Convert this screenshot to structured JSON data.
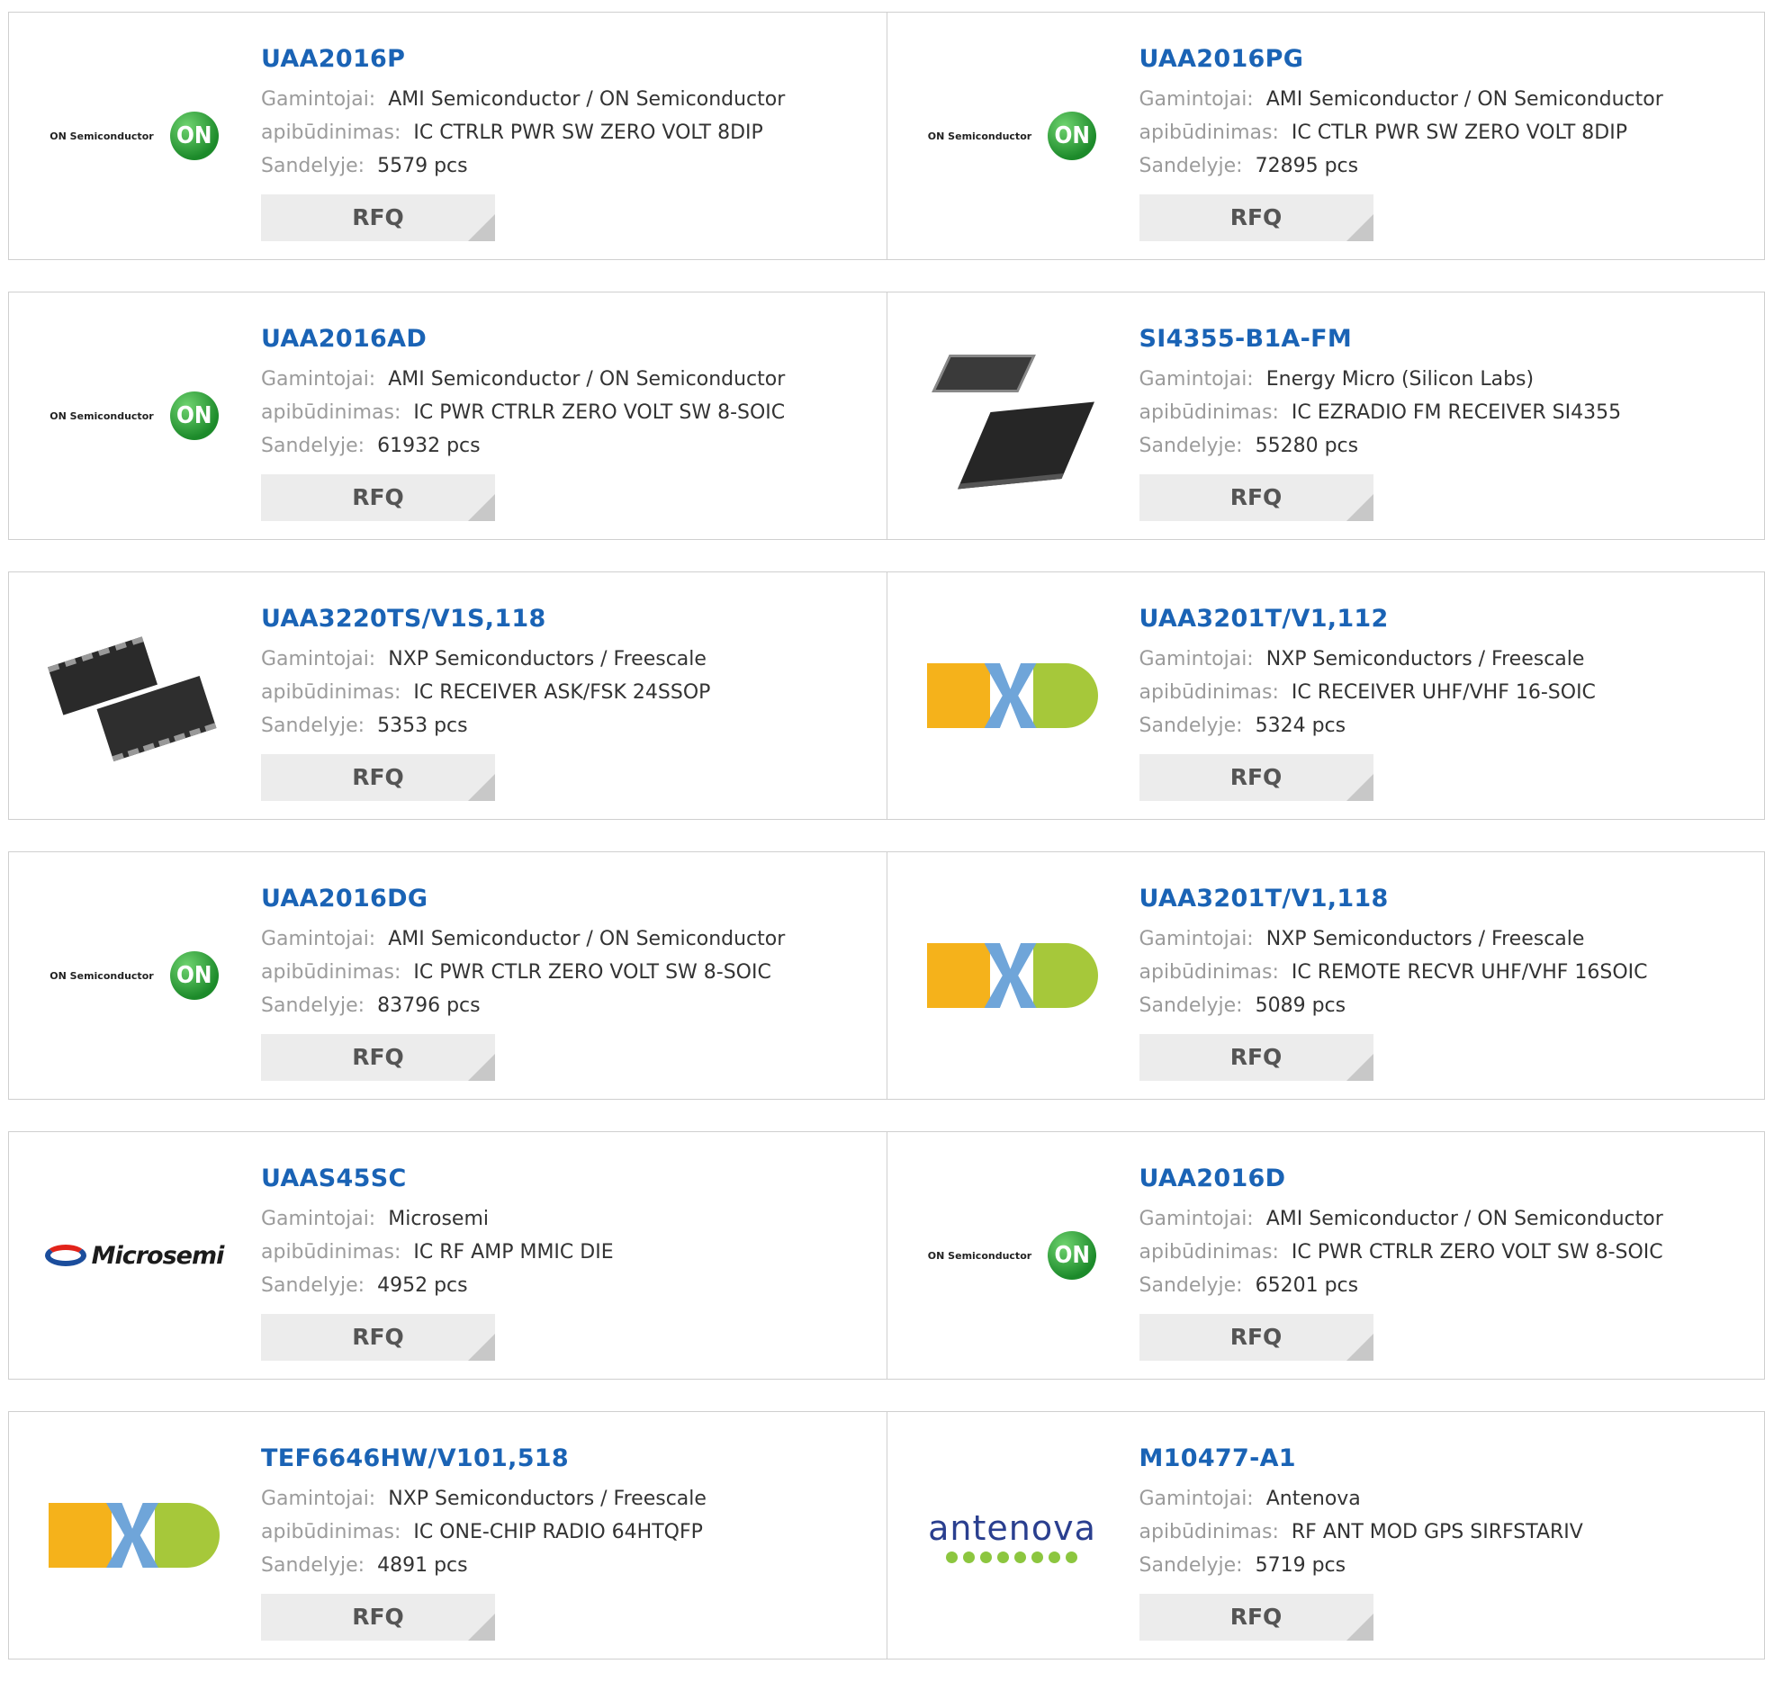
{
  "labels": {
    "manufacturer": "Gamintojai:",
    "description": "apibūdinimas:",
    "stock": "Sandelyje:",
    "rfq": "RFQ"
  },
  "colors": {
    "part_link": "#1a63b5",
    "rfq_bg": "#ececec",
    "border": "#cfcfcf"
  },
  "products": [
    {
      "part": "UAA2016P",
      "manufacturer": "AMI Semiconductor / ON Semiconductor",
      "description": "IC CTRLR PWR SW ZERO VOLT 8DIP",
      "stock": "5579 pcs",
      "image": "on-semiconductor-logo",
      "logo_text": "ON Semiconductor",
      "badge": "ON"
    },
    {
      "part": "UAA2016PG",
      "manufacturer": "AMI Semiconductor / ON Semiconductor",
      "description": "IC CTLR PWR SW ZERO VOLT 8DIP",
      "stock": "72895 pcs",
      "image": "on-semiconductor-logo",
      "logo_text": "ON Semiconductor",
      "badge": "ON"
    },
    {
      "part": "UAA2016AD",
      "manufacturer": "AMI Semiconductor / ON Semiconductor",
      "description": "IC PWR CTRLR ZERO VOLT SW 8-SOIC",
      "stock": "61932 pcs",
      "image": "on-semiconductor-logo",
      "logo_text": "ON Semiconductor",
      "badge": "ON"
    },
    {
      "part": "SI4355-B1A-FM",
      "manufacturer": "Energy Micro (Silicon Labs)",
      "description": "IC EZRADIO FM RECEIVER SI4355",
      "stock": "55280 pcs",
      "image": "qfn-chip-photo"
    },
    {
      "part": "UAA3220TS/V1S,118",
      "manufacturer": "NXP Semiconductors / Freescale",
      "description": "IC RECEIVER ASK/FSK 24SSOP",
      "stock": "5353 pcs",
      "image": "ssop-chip-photo"
    },
    {
      "part": "UAA3201T/V1,112",
      "manufacturer": "NXP Semiconductors / Freescale",
      "description": "IC RECEIVER UHF/VHF 16-SOIC",
      "stock": "5324 pcs",
      "image": "nxp-logo"
    },
    {
      "part": "UAA2016DG",
      "manufacturer": "AMI Semiconductor / ON Semiconductor",
      "description": "IC PWR CTLR ZERO VOLT SW 8-SOIC",
      "stock": "83796 pcs",
      "image": "on-semiconductor-logo",
      "logo_text": "ON Semiconductor",
      "badge": "ON"
    },
    {
      "part": "UAA3201T/V1,118",
      "manufacturer": "NXP Semiconductors / Freescale",
      "description": "IC REMOTE RECVR UHF/VHF 16SOIC",
      "stock": "5089 pcs",
      "image": "nxp-logo"
    },
    {
      "part": "UAAS45SC",
      "manufacturer": "Microsemi",
      "description": "IC RF AMP MMIC DIE",
      "stock": "4952 pcs",
      "image": "microsemi-logo",
      "logo_text": "Microsemi"
    },
    {
      "part": "UAA2016D",
      "manufacturer": "AMI Semiconductor / ON Semiconductor",
      "description": "IC PWR CTRLR ZERO VOLT SW 8-SOIC",
      "stock": "65201 pcs",
      "image": "on-semiconductor-logo",
      "logo_text": "ON Semiconductor",
      "badge": "ON"
    },
    {
      "part": "TEF6646HW/V101,518",
      "manufacturer": "NXP Semiconductors / Freescale",
      "description": "IC ONE-CHIP RADIO 64HTQFP",
      "stock": "4891 pcs",
      "image": "nxp-logo"
    },
    {
      "part": "M10477-A1",
      "manufacturer": "Antenova",
      "description": "RF ANT MOD GPS SIRFSTARIV",
      "stock": "5719 pcs",
      "image": "antenova-logo",
      "logo_text": "antenova"
    }
  ]
}
